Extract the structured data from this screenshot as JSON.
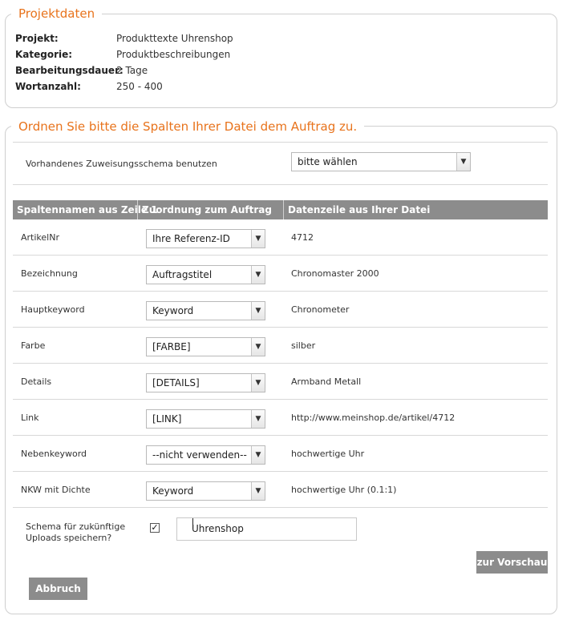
{
  "projekt": {
    "title": "Projektdaten",
    "rows": [
      {
        "label": "Projekt:",
        "value": "Produkttexte Uhrenshop"
      },
      {
        "label": "Kategorie:",
        "value": "Produktbeschreibungen"
      },
      {
        "label": "Bearbeitungsdauer:",
        "value": "2 Tage"
      },
      {
        "label": "Wortanzahl:",
        "value": "250 - 400"
      }
    ]
  },
  "mapping": {
    "title": "Ordnen Sie bitte die Spalten Ihrer Datei dem Auftrag zu.",
    "schema_label": "Vorhandenes Zuweisungsschema benutzen",
    "schema_select": "bitte wählen",
    "headers": [
      "Spaltennamen aus Zeile 1",
      "Zuordnung zum Auftrag",
      "Datenzeile aus Ihrer Datei"
    ],
    "rows": [
      {
        "name": "ArtikelNr",
        "assign": "Ihre Referenz-ID",
        "data": "4712"
      },
      {
        "name": "Bezeichnung",
        "assign": "Auftragstitel",
        "data": "Chronomaster 2000"
      },
      {
        "name": "Hauptkeyword",
        "assign": "Keyword",
        "data": "Chronometer"
      },
      {
        "name": "Farbe",
        "assign": "[FARBE]",
        "data": "silber"
      },
      {
        "name": "Details",
        "assign": "[DETAILS]",
        "data": "Armband Metall"
      },
      {
        "name": "Link",
        "assign": "[LINK]",
        "data": "http://www.meinshop.de/artikel/4712"
      },
      {
        "name": "Nebenkeyword",
        "assign": "--nicht verwenden--",
        "data": "hochwertige Uhr"
      },
      {
        "name": "NKW mit Dichte",
        "assign": "Keyword",
        "data": "hochwertige Uhr (0.1:1)"
      }
    ],
    "save_label_line1": "Schema für zukünftige",
    "save_label_line2": "Uploads speichern?",
    "save_checked": "✓",
    "save_name": "Uhrenshop",
    "preview_button": "zur Vorschau",
    "cancel_button": "Abbruch"
  },
  "colors": {
    "accent": "#e8731c",
    "header_bg": "#8c8c8c",
    "button_bg": "#8c8c8c"
  },
  "icons": {
    "dropdown": "chevron-down-icon",
    "checkbox": "checkmark-icon"
  }
}
